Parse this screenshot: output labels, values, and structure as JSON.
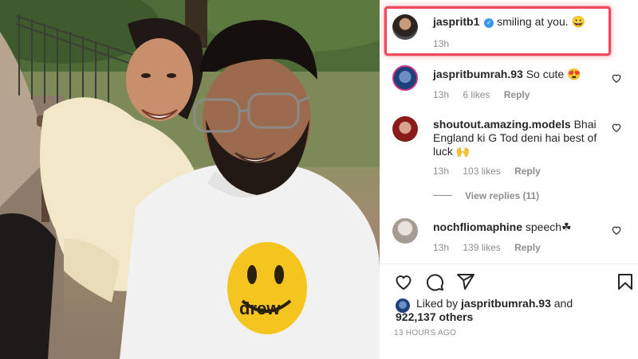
{
  "post": {
    "image_alt": "Selfie of a couple in a park, man wearing white hoodie with yellow smiley face"
  },
  "caption_comment": {
    "username": "jaspritb1",
    "verified": true,
    "text": "smiling at you. 😀",
    "time": "13h"
  },
  "comments": [
    {
      "username": "jaspritbumrah.93",
      "text": "So cute 😍",
      "time": "13h",
      "likes": "6 likes",
      "reply": "Reply"
    },
    {
      "username": "shoutout.amazing.models",
      "text": "Bhai England ki G Tod deni hai best of luck 🙌",
      "time": "13h",
      "likes": "103 likes",
      "reply": "Reply",
      "view_replies": "View replies (11)"
    },
    {
      "username": "nochfliomaphine",
      "text": "speech☘",
      "time": "13h",
      "likes": "139 likes",
      "reply": "Reply"
    }
  ],
  "actions": {
    "like_icon": "heart-icon",
    "comment_icon": "comment-icon",
    "share_icon": "share-icon",
    "save_icon": "bookmark-icon"
  },
  "likes_summary": {
    "prefix": "Liked by ",
    "user": "jaspritbumrah.93",
    "middle": " and",
    "count": "922,137 others"
  },
  "timestamp": "13 HOURS AGO",
  "colors": {
    "highlight": "#f04a5a",
    "verified": "#3897f0",
    "meta": "#8e8e8e"
  }
}
